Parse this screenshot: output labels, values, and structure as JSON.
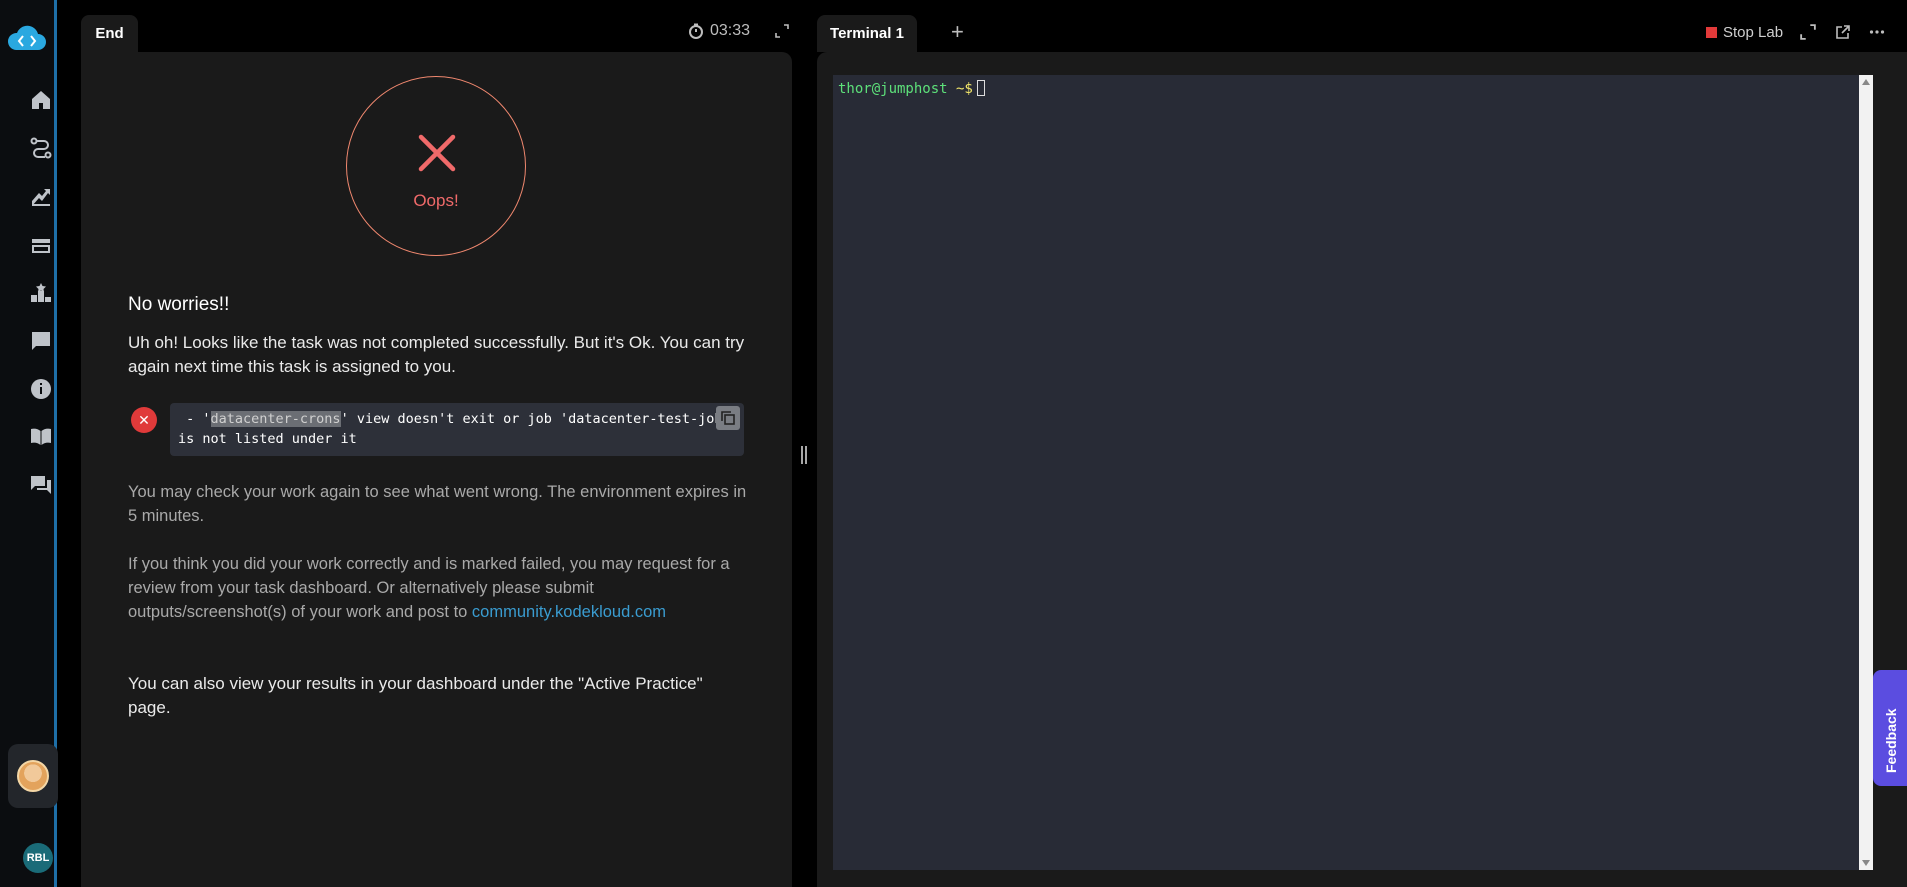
{
  "sidebar": {
    "items": [
      {
        "name": "home-icon"
      },
      {
        "name": "roadmap-icon"
      },
      {
        "name": "growth-icon"
      },
      {
        "name": "labs-icon"
      },
      {
        "name": "leaderboard-icon"
      },
      {
        "name": "notes-icon"
      },
      {
        "name": "info-icon"
      },
      {
        "name": "book-icon"
      },
      {
        "name": "chat-icon"
      }
    ],
    "user_initials": "RBL"
  },
  "left_pane": {
    "tab_label": "End",
    "timer": "03:33",
    "result_label": "Oops!",
    "heading": "No worries!!",
    "message": "Uh oh! Looks like the task was not completed successfully. But it's Ok. You can try again next time this task is assigned to you.",
    "error_prefix": " - '",
    "error_highlight": "datacenter-crons",
    "error_suffix": "' view doesn't exit or job 'datacenter-test-job' is not listed under it",
    "check_again": "You may check your work again to see what went wrong. The environment expires in 5 minutes.",
    "review_text": "If you think you did your work correctly and is marked failed, you may request for a review from your task dashboard. Or alternatively please submit outputs/screenshot(s) of your work and post to ",
    "review_link": "community.kodekloud.com",
    "dashboard_note": "You can also view your results in your dashboard under the \"Active Practice\" page."
  },
  "right_pane": {
    "tab_label": "Terminal 1",
    "add_tab": "+",
    "stop_lab": "Stop Lab",
    "prompt_user": "thor@jumphost",
    "prompt_dir": " ~$",
    "feedback": "Feedback"
  },
  "colors": {
    "accent": "#1e6fa8",
    "error": "#e03a3a",
    "feedback": "#5b4de0",
    "link": "#3a9cd0"
  }
}
